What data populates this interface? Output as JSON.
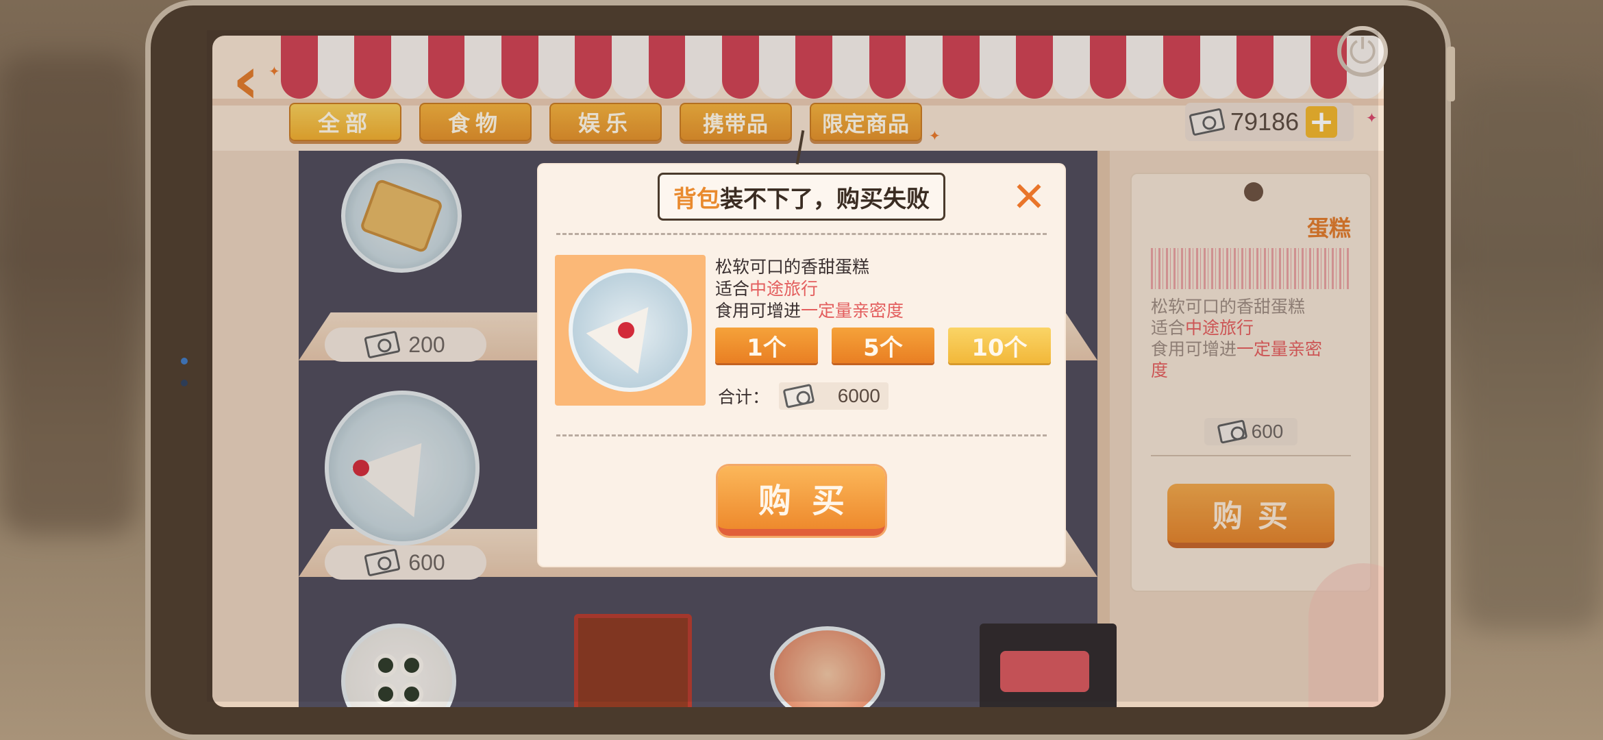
{
  "header": {
    "tabs": [
      {
        "label": "全部",
        "active": true
      },
      {
        "label": "食物",
        "active": false
      },
      {
        "label": "娱乐",
        "active": false
      },
      {
        "label": "携带品",
        "active": false
      },
      {
        "label": "限定商品",
        "active": false
      }
    ],
    "currency": {
      "value": "79186",
      "icon": "cash-icon",
      "add_icon": "plus-icon"
    },
    "back_icon": "chevron-left-icon",
    "power_icon": "power-icon"
  },
  "shelf": {
    "prices": [
      "200",
      "600"
    ]
  },
  "info_panel": {
    "title": "蛋糕",
    "desc_line1": "松软可口的香甜蛋糕",
    "desc_line2_prefix": "适合",
    "desc_line2_highlight": "中途旅行",
    "desc_line3_prefix": "食用可增进",
    "desc_line3_highlight": "一定量亲密",
    "desc_line4": "度",
    "price": "600",
    "buy_label": "购买"
  },
  "modal": {
    "header_highlight": "背包",
    "header_rest": "装不下了，购买失败",
    "item_desc_line1": "松软可口的香甜蛋糕",
    "item_desc_line2_prefix": "适合",
    "item_desc_line2_highlight": "中途旅行",
    "item_desc_line3_prefix": "食用可增进",
    "item_desc_line3_highlight": "一定量亲密度",
    "qty_options": [
      "1个",
      "5个",
      "10个"
    ],
    "total_label": "合计：",
    "total_value": "6000",
    "buy_label": "购买"
  },
  "colors": {
    "accent_orange": "#e98a2e",
    "highlight_red": "#e35d5d",
    "awning_red": "#cf4152"
  }
}
